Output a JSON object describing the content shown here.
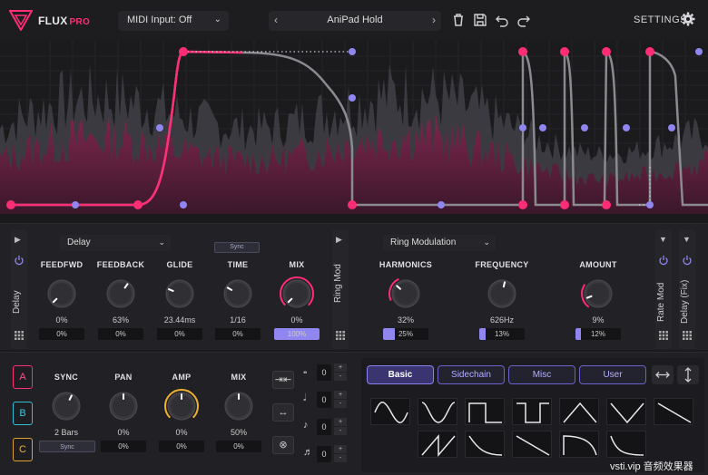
{
  "brand": {
    "name": "FLUX",
    "suffix": "PRO"
  },
  "top": {
    "midi_input": "MIDI Input: Off",
    "preset_name": "AniPad Hold",
    "settings_label": "SETTINGS"
  },
  "colors": {
    "accent": "#ff2d74",
    "purple": "#8f86f0",
    "knob_orange": "#f0b030"
  },
  "delay": {
    "title": "Delay",
    "type": "Delay",
    "sync_label": "Sync",
    "knobs": [
      {
        "label": "FEEDFWD",
        "value": "0%",
        "box": "0%",
        "level": 0
      },
      {
        "label": "FEEDBACK",
        "value": "63%",
        "box": "0%",
        "level": 0.63
      },
      {
        "label": "GLIDE",
        "value": "23.44ms",
        "box": "0%",
        "level": 0.25
      },
      {
        "label": "TIME",
        "value": "1/16",
        "box": "0%",
        "level": 0.28
      },
      {
        "label": "MIX",
        "value": "0%",
        "box": "100%",
        "level": 0.0
      }
    ]
  },
  "ring": {
    "title": "Ring Mod",
    "type": "Ring Modulation",
    "knobs": [
      {
        "label": "HARMONICS",
        "value": "32%",
        "box": "25%",
        "level": 0.32
      },
      {
        "label": "FREQUENCY",
        "value": "626Hz",
        "box": "13%",
        "level": 0.55
      },
      {
        "label": "AMOUNT",
        "value": "9%",
        "box": "12%",
        "level": 0.09
      }
    ]
  },
  "right_strips": [
    "Rate Mod",
    "Delay (Fix)"
  ],
  "lfo": {
    "letters": [
      "A",
      "B",
      "C"
    ],
    "knobs": [
      {
        "label": "SYNC",
        "value": "2 Bars",
        "box": "Sync",
        "level": 0.6
      },
      {
        "label": "PAN",
        "value": "0%",
        "box": "0%",
        "level": 0.5
      },
      {
        "label": "AMP",
        "value": "0%",
        "box": "0%",
        "level": 0.5
      },
      {
        "label": "MIX",
        "value": "50%",
        "box": "0%",
        "level": 0.5
      }
    ],
    "note_values": [
      "0",
      "0",
      "0",
      "0"
    ]
  },
  "tabs": [
    "Basic",
    "Sidechain",
    "Misc",
    "User"
  ],
  "watermark": "vsti.vip 音频效果器"
}
